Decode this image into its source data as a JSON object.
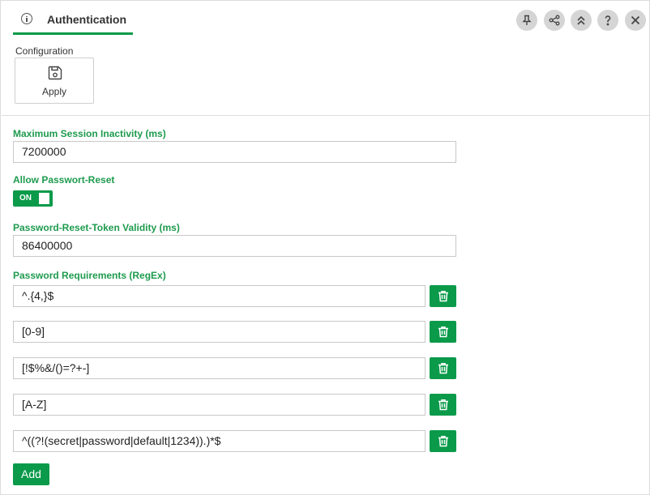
{
  "header": {
    "title": "Authentication",
    "info_icon": "info-icon",
    "actions": [
      {
        "name": "pin-icon"
      },
      {
        "name": "share-icon"
      },
      {
        "name": "collapse-icon"
      },
      {
        "name": "help-icon"
      },
      {
        "name": "close-icon"
      }
    ]
  },
  "toolbar": {
    "section_label": "Configuration",
    "apply_label": "Apply",
    "apply_icon": "save-icon"
  },
  "form": {
    "session_inactivity": {
      "label": "Maximum Session Inactivity (ms)",
      "value": "7200000"
    },
    "allow_reset": {
      "label": "Allow Passwort-Reset",
      "state": "ON"
    },
    "token_validity": {
      "label": "Password-Reset-Token Validity (ms)",
      "value": "86400000"
    },
    "requirements": {
      "label": "Password Requirements (RegEx)",
      "items": [
        "^.{4,}$",
        "[0-9]",
        "[!$%&/()=?+-]",
        "[A-Z]",
        "^((?!(secret|password|default|1234)).)*$"
      ],
      "delete_icon": "trash-icon",
      "add_label": "Add"
    }
  },
  "colors": {
    "accent": "#0a9a4a",
    "label": "#1e9b4e",
    "header_button": "#d5d5d5"
  }
}
